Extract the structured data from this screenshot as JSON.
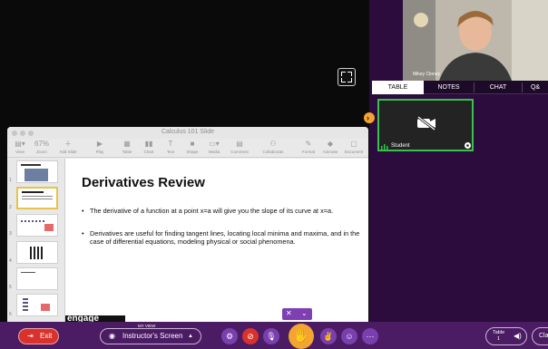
{
  "keynote": {
    "window_title": "Calculus 101 Slide",
    "toolbar": [
      "View",
      "Zoom",
      "Add Slide",
      "Play",
      "Table",
      "Chart",
      "Text",
      "Shape",
      "Media",
      "Comment",
      "Collaborate",
      "Format",
      "Animate",
      "Document"
    ],
    "zoom_value": "67%",
    "slide": {
      "title": "Derivatives Review",
      "bullets": [
        "The derivative of a function at a point x=a will give you the slope of its curve at x=a.",
        "Derivatives are useful for finding tangent lines, locating local minima and maxima, and in the case of differential equations, modeling physical or social phenomena."
      ],
      "logo_text": "engage"
    },
    "slide_numbers": [
      "1",
      "2",
      "3",
      "4",
      "5",
      "6"
    ]
  },
  "right_panel": {
    "camera_name": "Mikey Cloney",
    "tabs": [
      "TABLE",
      "NOTES",
      "CHAT",
      "Q&"
    ],
    "active_tab": "TABLE",
    "student_label": "Student"
  },
  "bottom_bar": {
    "exit_label": "Exit",
    "my_view_label": "MY VIEW",
    "view_value": "Instructor's Screen",
    "table_label": "Table",
    "table_number": "1",
    "cut_label": "Cla"
  },
  "colors": {
    "accent": "#f2a531",
    "bar": "#4b1b63",
    "panel": "#2b0c3c",
    "exit": "#d9322c",
    "camera_border": "#37c24a"
  },
  "icons": [
    "expand-icon",
    "settings-icon",
    "video-off-icon",
    "mic-icon",
    "hand-icon",
    "reaction-icon",
    "emoji-icon",
    "more-icon",
    "speaker-icon",
    "chevron-right-icon"
  ]
}
